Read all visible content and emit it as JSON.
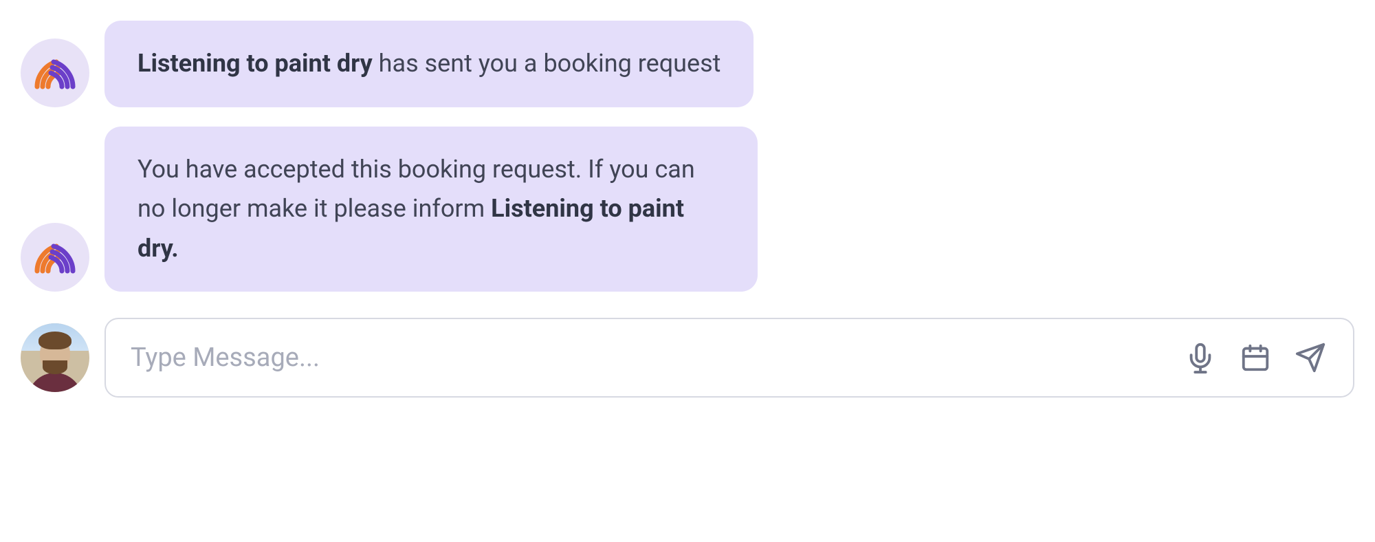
{
  "messages": [
    {
      "avatar": "system-logo",
      "prefix_bold": "Listening to paint dry",
      "suffix_text": " has sent you a booking request"
    },
    {
      "avatar": "system-logo",
      "prefix_text": "You have accepted this booking request. If you can no longer make it please inform ",
      "suffix_bold": "Listening to paint dry."
    }
  ],
  "composer": {
    "placeholder": "Type Message...",
    "value": "",
    "icons": [
      "microphone",
      "calendar",
      "send"
    ]
  }
}
